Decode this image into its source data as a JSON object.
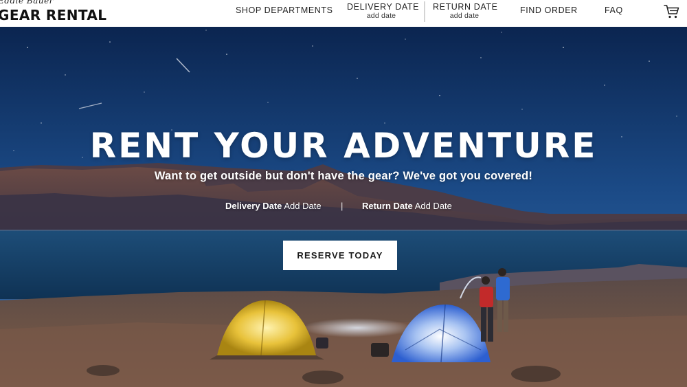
{
  "brand": {
    "script": "Eddie Bauer",
    "name": "GEAR RENTAL"
  },
  "nav": {
    "shop_departments": "SHOP DEPARTMENTS",
    "delivery_date": {
      "label": "DELIVERY DATE",
      "value": "add date"
    },
    "return_date": {
      "label": "RETURN DATE",
      "value": "add date"
    },
    "find_order": "FIND ORDER",
    "faq": "FAQ",
    "cart_icon": "shopping-cart-icon"
  },
  "hero": {
    "headline": "RENT YOUR ADVENTURE",
    "subheadline": "Want to get outside but don't have the gear? We've got you covered!",
    "delivery": {
      "label": "Delivery Date",
      "value": "Add Date"
    },
    "separator": "|",
    "return": {
      "label": "Return Date",
      "value": "Add Date"
    },
    "cta": "RESERVE TODAY",
    "background": "night-desert-lake-campsite-photo"
  },
  "colors": {
    "sky_top": "#0d2a55",
    "sky_mid": "#1f4f8c",
    "lake": "#123c63",
    "sand": "#6b5246",
    "tent_yellow": "#e8c23a",
    "tent_blue": "#2d5fd0"
  }
}
